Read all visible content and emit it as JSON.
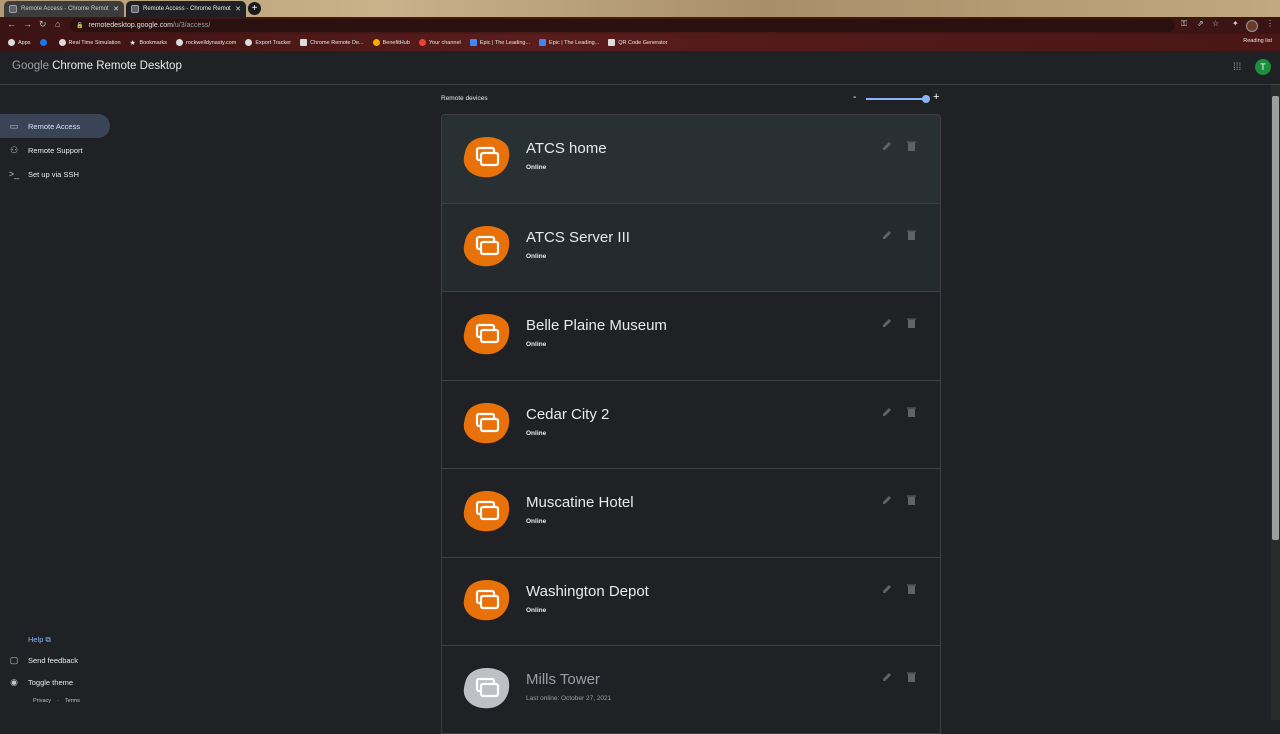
{
  "browser": {
    "tabs": [
      {
        "title": "Remote Access - Chrome Remot"
      },
      {
        "title": "Remote Access - Chrome Remot"
      }
    ],
    "url": {
      "host": "remotedesktop.google.com",
      "path": "/u/3/access/"
    },
    "bookmarks": [
      "Apps",
      "Real Time Simulation",
      "Bookmarks",
      "rockwelldynasty.com",
      "Export Tracker",
      "Chrome Remote De...",
      "BenefitHub",
      "Your channel",
      "Epic | The Leading...",
      "Epic | The Leading...",
      "QR Code Generator"
    ],
    "reading_list": "Reading list"
  },
  "header": {
    "logo_google": "Google",
    "logo_product": "Chrome Remote Desktop",
    "avatar_initial": "T"
  },
  "sidebar": {
    "items": [
      {
        "label": "Remote Access",
        "icon": "laptop-icon",
        "active": true
      },
      {
        "label": "Remote Support",
        "icon": "people-icon",
        "active": false
      },
      {
        "label": "Set up via SSH",
        "icon": "terminal-icon",
        "active": false
      }
    ],
    "help": "Help",
    "send_feedback": "Send feedback",
    "toggle_theme": "Toggle theme",
    "privacy": "Privacy",
    "terms": "Terms"
  },
  "main": {
    "section_title": "Remote devices",
    "zoom_minus": "-",
    "zoom_plus": "+",
    "devices": [
      {
        "name": "ATCS home",
        "status": "Online",
        "online": true
      },
      {
        "name": "ATCS Server III",
        "status": "Online",
        "online": true
      },
      {
        "name": "Belle Plaine Museum",
        "status": "Online",
        "online": true
      },
      {
        "name": "Cedar City 2",
        "status": "Online",
        "online": true
      },
      {
        "name": "Muscatine Hotel",
        "status": "Online",
        "online": true
      },
      {
        "name": "Washington Depot",
        "status": "Online",
        "online": true
      },
      {
        "name": "Mills Tower",
        "status": "Last online: October 27, 2021",
        "online": false
      }
    ]
  },
  "colors": {
    "online_icon": "#e8710a",
    "offline_icon": "#bdc1c6",
    "accent": "#8ab4f8"
  }
}
